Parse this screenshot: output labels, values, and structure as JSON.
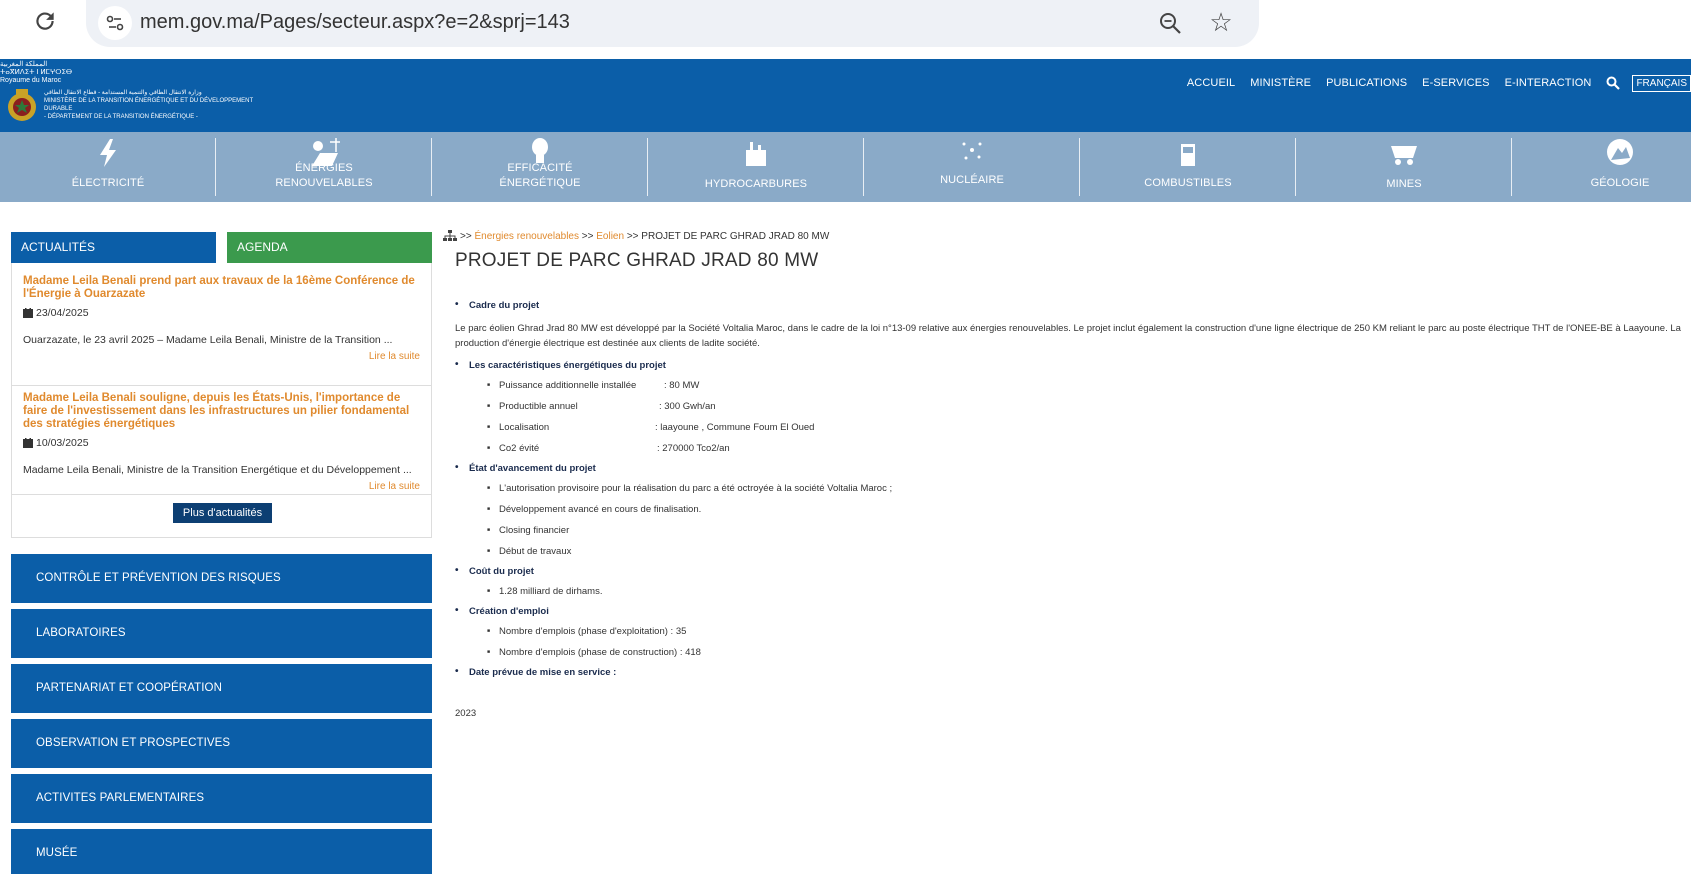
{
  "browser": {
    "url": "mem.gov.ma/Pages/secteur.aspx?e=2&sprj=143"
  },
  "header": {
    "logo_text_top": "المملكة المغربية\nⵜⴰⴳⵍⴷⵉⵜ ⵏ ⵍⵎⵖⵔⵉⴱ\nRoyaume du Maroc",
    "logo_text_right": "وزارة الانتقال الطاقي والتنمية المستدامة - قطاع الانتقال الطاقي\nMINISTÈRE DE LA TRANSITION ÉNERGÉTIQUE ET DU DÉVELOPPEMENT DURABLE\n- DÉPARTEMENT DE LA TRANSITION ÉNERGÉTIQUE -",
    "nav": [
      "ACCUEIL",
      "MINISTÈRE",
      "PUBLICATIONS",
      "E-SERVICES",
      "E-INTERACTION"
    ],
    "lang": "FRANÇAIS"
  },
  "sectors": [
    {
      "label": "ÉLECTRICITÉ",
      "icon": "lightning-icon"
    },
    {
      "label": "ÉNERGIES\nRENOUVELABLES",
      "icon": "solar-icon"
    },
    {
      "label": "EFFICACITÉ\nÉNERGÉTIQUE",
      "icon": "bulb-icon"
    },
    {
      "label": "HYDROCARBURES",
      "icon": "refinery-icon"
    },
    {
      "label": "NUCLÉAIRE",
      "icon": "atom-icon"
    },
    {
      "label": "COMBUSTIBLES",
      "icon": "fuel-icon"
    },
    {
      "label": "MINES",
      "icon": "mine-cart-icon"
    },
    {
      "label": "GÉOLOGIE",
      "icon": "geology-icon"
    }
  ],
  "sidebar": {
    "tab_news": "ACTUALITÉS",
    "tab_agenda": "AGENDA",
    "news": [
      {
        "title": "Madame Leila Benali prend part aux travaux de la 16ème Conférence de l'Énergie à Ouarzazate",
        "date": "23/04/2025",
        "excerpt": "Ouarzazate, le 23 avril 2025 – Madame Leila Benali, Ministre de la Transition ...",
        "more": "Lire la suite"
      },
      {
        "title": "Madame Leila Benali souligne, depuis les États-Unis, l'importance de faire de l'investissement dans les infrastructures un pilier fondamental des stratégies énergétiques",
        "date": "10/03/2025",
        "excerpt": "Madame Leila Benali, Ministre de la Transition Energétique et du Développement ...",
        "more": "Lire la suite"
      }
    ],
    "more_news": "Plus d'actualités",
    "menu": [
      "CONTRÔLE ET PRÉVENTION DES RISQUES",
      "LABORATOIRES",
      "PARTENARIAT ET COOPÉRATION",
      "OBSERVATION ET PROSPECTIVES",
      "ACTIVITES PARLEMENTAIRES",
      "MUSÉE"
    ]
  },
  "breadcrumb": {
    "sep": ">>",
    "items": [
      "Énergies renouvelables",
      "Eolien",
      "PROJET DE PARC GHRAD JRAD 80 MW"
    ]
  },
  "page": {
    "title": "PROJET DE PARC GHRAD JRAD 80 MW",
    "cadre_head": "Cadre du projet",
    "cadre_text": "Le parc éolien Ghrad Jrad 80 MW est développé par la Société Voltalia Maroc,  dans le cadre de la loi n°13-09 relative aux énergies renouvelables. Le projet inclut également la construction d'une ligne électrique de 250 KM reliant le parc au poste électrique THT de l'ONEE-BE à Laayoune. La production d'énergie électrique est destinée aux clients de ladite société.",
    "carac_head": "Les caractéristiques énergétiques du projet",
    "carac": [
      {
        "k": "Puissance additionnelle installée",
        "v": ": 80 MW"
      },
      {
        "k": "Productible annuel",
        "v": ": 300 Gwh/an"
      },
      {
        "k": "Localisation",
        "v": ": laayoune , Commune Foum El Oued"
      },
      {
        "k": "Co2 évité",
        "v": ": 270000  Tco2/an"
      }
    ],
    "etat_head": "État d'avancement du projet",
    "etat": [
      "L'autorisation provisoire pour la réalisation du parc a été octroyée à la société Voltalia Maroc ;",
      "Développement avancé en cours de finalisation.",
      "Closing financier",
      "Début de travaux"
    ],
    "cout_head": "Coût du projet",
    "cout": [
      "1.28 milliard de dirhams."
    ],
    "emploi_head": "Création d'emploi",
    "emploi": [
      "Nombre d'emplois (phase d'exploitation) : 35",
      "Nombre d'emplois (phase de construction) : 418"
    ],
    "date_head": "Date prévue de mise en service :",
    "date_value": "2023"
  }
}
